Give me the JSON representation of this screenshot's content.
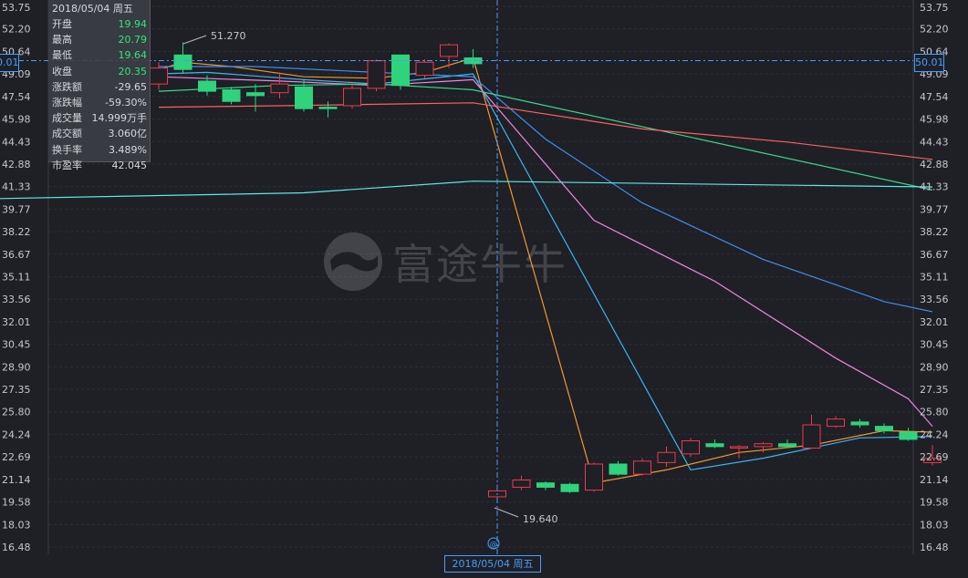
{
  "chart_data": {
    "type": "candlestick",
    "y_ticks": [
      "53.75",
      "52.20",
      "50.64",
      "49.09",
      "47.54",
      "45.98",
      "44.43",
      "42.88",
      "41.33",
      "39.77",
      "38.22",
      "36.67",
      "35.11",
      "33.56",
      "32.01",
      "30.45",
      "28.90",
      "27.35",
      "25.80",
      "24.24",
      "22.69",
      "21.14",
      "19.58",
      "18.03",
      "16.48"
    ],
    "ylim": [
      16.48,
      53.75
    ],
    "crosshair_price": "50.01",
    "crosshair_date": "2018/05/04 周五",
    "annotation_high": "51.270",
    "annotation_low": "19.640",
    "info_panel": {
      "date": "2018/05/04 周五",
      "rows": [
        {
          "label": "开盘",
          "value": "19.94"
        },
        {
          "label": "最高",
          "value": "20.79"
        },
        {
          "label": "最低",
          "value": "19.64"
        },
        {
          "label": "收盘",
          "value": "20.35"
        },
        {
          "label": "涨跌额",
          "value": "-29.65"
        },
        {
          "label": "涨跌幅",
          "value": "-59.30%"
        },
        {
          "label": "成交量",
          "value": "14.999万手"
        },
        {
          "label": "成交额",
          "value": "3.060亿"
        },
        {
          "label": "换手率",
          "value": "3.489%"
        },
        {
          "label": "市盈率",
          "value": "42.045"
        }
      ]
    },
    "candles": [
      {
        "o": 48.4,
        "c": 49.5,
        "h": 49.9,
        "l": 48.0
      },
      {
        "o": 50.4,
        "c": 49.4,
        "h": 51.27,
        "l": 49.1
      },
      {
        "o": 48.6,
        "c": 47.9,
        "h": 49.0,
        "l": 47.6
      },
      {
        "o": 48.0,
        "c": 47.2,
        "h": 48.2,
        "l": 47.0
      },
      {
        "o": 47.8,
        "c": 47.6,
        "h": 48.4,
        "l": 46.5
      },
      {
        "o": 47.8,
        "c": 48.4,
        "h": 49.2,
        "l": 47.4
      },
      {
        "o": 48.2,
        "c": 46.7,
        "h": 48.7,
        "l": 46.5
      },
      {
        "o": 46.8,
        "c": 46.7,
        "h": 47.2,
        "l": 46.1
      },
      {
        "o": 46.9,
        "c": 48.1,
        "h": 48.5,
        "l": 46.7
      },
      {
        "o": 48.1,
        "c": 50.0,
        "h": 50.1,
        "l": 47.9
      },
      {
        "o": 50.4,
        "c": 48.3,
        "h": 50.4,
        "l": 48.0
      },
      {
        "o": 49.0,
        "c": 49.9,
        "h": 50.1,
        "l": 48.8
      },
      {
        "o": 50.3,
        "c": 51.1,
        "h": 51.2,
        "l": 49.5
      },
      {
        "o": 50.2,
        "c": 49.8,
        "h": 50.8,
        "l": 49.5
      },
      {
        "o": 19.94,
        "c": 20.35,
        "h": 20.79,
        "l": 19.64
      },
      {
        "o": 20.6,
        "c": 21.1,
        "h": 21.4,
        "l": 20.4
      },
      {
        "o": 20.9,
        "c": 20.6,
        "h": 21.0,
        "l": 20.4
      },
      {
        "o": 20.8,
        "c": 20.3,
        "h": 20.9,
        "l": 20.2
      },
      {
        "o": 20.4,
        "c": 22.2,
        "h": 22.3,
        "l": 20.3
      },
      {
        "o": 22.2,
        "c": 21.5,
        "h": 22.4,
        "l": 21.4
      },
      {
        "o": 21.5,
        "c": 22.4,
        "h": 22.6,
        "l": 21.4
      },
      {
        "o": 22.3,
        "c": 23.0,
        "h": 23.4,
        "l": 22.0
      },
      {
        "o": 22.9,
        "c": 23.8,
        "h": 24.0,
        "l": 22.7
      },
      {
        "o": 23.6,
        "c": 23.4,
        "h": 23.9,
        "l": 23.3
      },
      {
        "o": 23.3,
        "c": 23.4,
        "h": 23.5,
        "l": 22.6
      },
      {
        "o": 23.4,
        "c": 23.6,
        "h": 23.7,
        "l": 23.0
      },
      {
        "o": 23.6,
        "c": 23.4,
        "h": 23.9,
        "l": 23.3
      },
      {
        "o": 23.3,
        "c": 24.9,
        "h": 25.6,
        "l": 23.3
      },
      {
        "o": 24.8,
        "c": 25.3,
        "h": 25.5,
        "l": 24.7
      },
      {
        "o": 25.1,
        "c": 24.9,
        "h": 25.3,
        "l": 24.7
      },
      {
        "o": 24.8,
        "c": 24.5,
        "h": 25.0,
        "l": 24.3
      },
      {
        "o": 24.4,
        "c": 23.9,
        "h": 24.7,
        "l": 23.8
      },
      {
        "o": 22.3,
        "c": 22.6,
        "h": 23.5,
        "l": 22.1
      }
    ],
    "moving_averages": [
      {
        "color": "#f5962f",
        "points": [
          [
            0,
            49.4
          ],
          [
            1,
            49.9
          ],
          [
            3,
            49.6
          ],
          [
            6,
            48.9
          ],
          [
            9,
            48.8
          ],
          [
            11,
            49.2
          ],
          [
            13,
            50.2
          ],
          [
            18,
            20.9
          ],
          [
            21,
            21.8
          ],
          [
            24,
            23.0
          ],
          [
            27,
            23.5
          ],
          [
            30,
            24.5
          ],
          [
            32,
            24.4
          ]
        ]
      },
      {
        "color": "#3fb3f2",
        "points": [
          [
            0,
            49.1
          ],
          [
            2,
            49.2
          ],
          [
            6,
            48.7
          ],
          [
            9,
            48.4
          ],
          [
            13,
            49.1
          ],
          [
            22,
            21.8
          ],
          [
            25,
            22.6
          ],
          [
            29,
            24.0
          ],
          [
            32,
            24.1
          ]
        ]
      },
      {
        "color": "#f087e0",
        "points": [
          [
            0,
            48.9
          ],
          [
            5,
            48.6
          ],
          [
            9,
            48.3
          ],
          [
            13,
            48.7
          ],
          [
            18,
            39.0
          ],
          [
            23,
            34.8
          ],
          [
            28,
            29.5
          ],
          [
            31,
            26.7
          ],
          [
            32,
            24.8
          ]
        ]
      },
      {
        "color": "#3d8ef0",
        "points": [
          [
            0,
            49.6
          ],
          [
            4,
            49.6
          ],
          [
            9,
            49.2
          ],
          [
            13,
            48.9
          ],
          [
            16,
            44.6
          ],
          [
            20,
            40.2
          ],
          [
            25,
            36.3
          ],
          [
            30,
            33.4
          ],
          [
            32,
            32.7
          ]
        ]
      },
      {
        "color": "#3dd68a",
        "points": [
          [
            0,
            47.9
          ],
          [
            5,
            48.3
          ],
          [
            9,
            48.4
          ],
          [
            13,
            48.0
          ],
          [
            32,
            41.1
          ]
        ]
      },
      {
        "color": "#ff5f5f",
        "points": [
          [
            0,
            46.8
          ],
          [
            5,
            46.9
          ],
          [
            9,
            47.0
          ],
          [
            13,
            47.1
          ],
          [
            20,
            45.3
          ],
          [
            26,
            44.4
          ],
          [
            32,
            43.2
          ]
        ]
      },
      {
        "color": "#5fe8e2",
        "points": [
          [
            -1,
            40.5
          ],
          [
            6,
            40.9
          ],
          [
            13,
            41.7
          ],
          [
            32,
            41.3
          ]
        ]
      }
    ]
  },
  "watermark": {
    "text": "富途牛牛"
  }
}
